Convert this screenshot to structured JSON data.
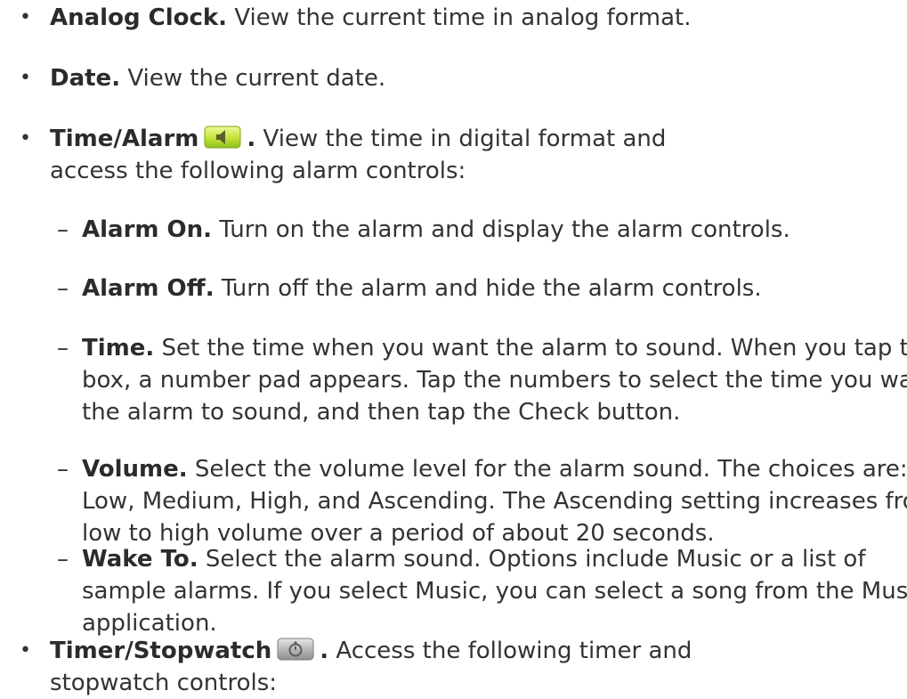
{
  "items": [
    {
      "term": "Analog Clock.",
      "text": "View the current time in analog format."
    },
    {
      "term": "Date.",
      "text": "View the current date."
    },
    {
      "term": "Time/Alarm",
      "icon": "alarm-speaker-icon",
      "text": "View the time in digital format and access the following alarm controls:",
      "subitems": [
        {
          "term": "Alarm On.",
          "text": "Turn on the alarm and display the alarm controls."
        },
        {
          "term": "Alarm Off.",
          "text": "Turn off the alarm and hide the alarm controls."
        },
        {
          "term": "Time.",
          "text": "Set the time when you want the alarm to sound. When you tap this box, a number pad appears. Tap the numbers to select the time you want the alarm to sound, and then tap the Check button."
        },
        {
          "term": "Volume.",
          "text": "Select the volume level for the alarm sound. The choices are: Low, Medium, High, and Ascending. The Ascending setting increases from low to high volume over a period of about 20 seconds."
        },
        {
          "term": "Wake To.",
          "text": "Select the alarm sound. Options include Music or a list of sample alarms. If you select Music, you can select a song from the Music application."
        }
      ]
    },
    {
      "term": "Timer/Stopwatch",
      "icon": "stopwatch-icon",
      "text": "Access the following timer and stopwatch controls:"
    }
  ]
}
